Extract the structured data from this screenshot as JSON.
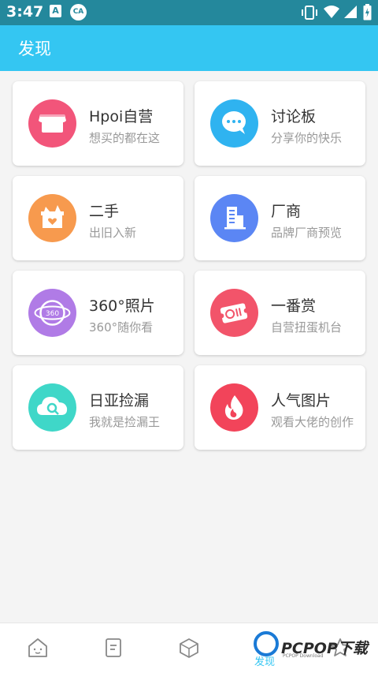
{
  "status_bar": {
    "time": "3:47",
    "notif_1": "A",
    "notif_2": "CA"
  },
  "app_bar": {
    "title": "发现"
  },
  "cards": [
    {
      "title": "Hpoi自营",
      "subtitle": "想买的都在这",
      "icon": "store-icon",
      "color": "#f2557a"
    },
    {
      "title": "讨论板",
      "subtitle": "分享你的快乐",
      "icon": "chat-bubble-icon",
      "color": "#2fb3f0"
    },
    {
      "title": "二手",
      "subtitle": "出旧入新",
      "icon": "box-heart-icon",
      "color": "#f79a4e"
    },
    {
      "title": "厂商",
      "subtitle": "品牌厂商预览",
      "icon": "building-icon",
      "color": "#5b86f4"
    },
    {
      "title": "360°照片",
      "subtitle": "360°随你看",
      "icon": "360-globe-icon",
      "color": "#b07be6"
    },
    {
      "title": "一番赏",
      "subtitle": "自营扭蛋机台",
      "icon": "ticket-icon",
      "color": "#f2546a"
    },
    {
      "title": "日亚捡漏",
      "subtitle": "我就是捡漏王",
      "icon": "cloud-search-icon",
      "color": "#3fd7c8"
    },
    {
      "title": "人气图片",
      "subtitle": "观看大佬的创作",
      "icon": "fire-icon",
      "color": "#f2445a"
    }
  ],
  "bottom_nav": {
    "items": [
      {
        "icon": "home-face-icon",
        "label": ""
      },
      {
        "icon": "document-icon",
        "label": ""
      },
      {
        "icon": "cube-icon",
        "label": ""
      },
      {
        "icon": "discover-icon",
        "label": "发现"
      },
      {
        "icon": "star-icon",
        "label": ""
      }
    ]
  },
  "watermark": {
    "text": "PCPOP下载",
    "sub": "PCPOP Download"
  }
}
